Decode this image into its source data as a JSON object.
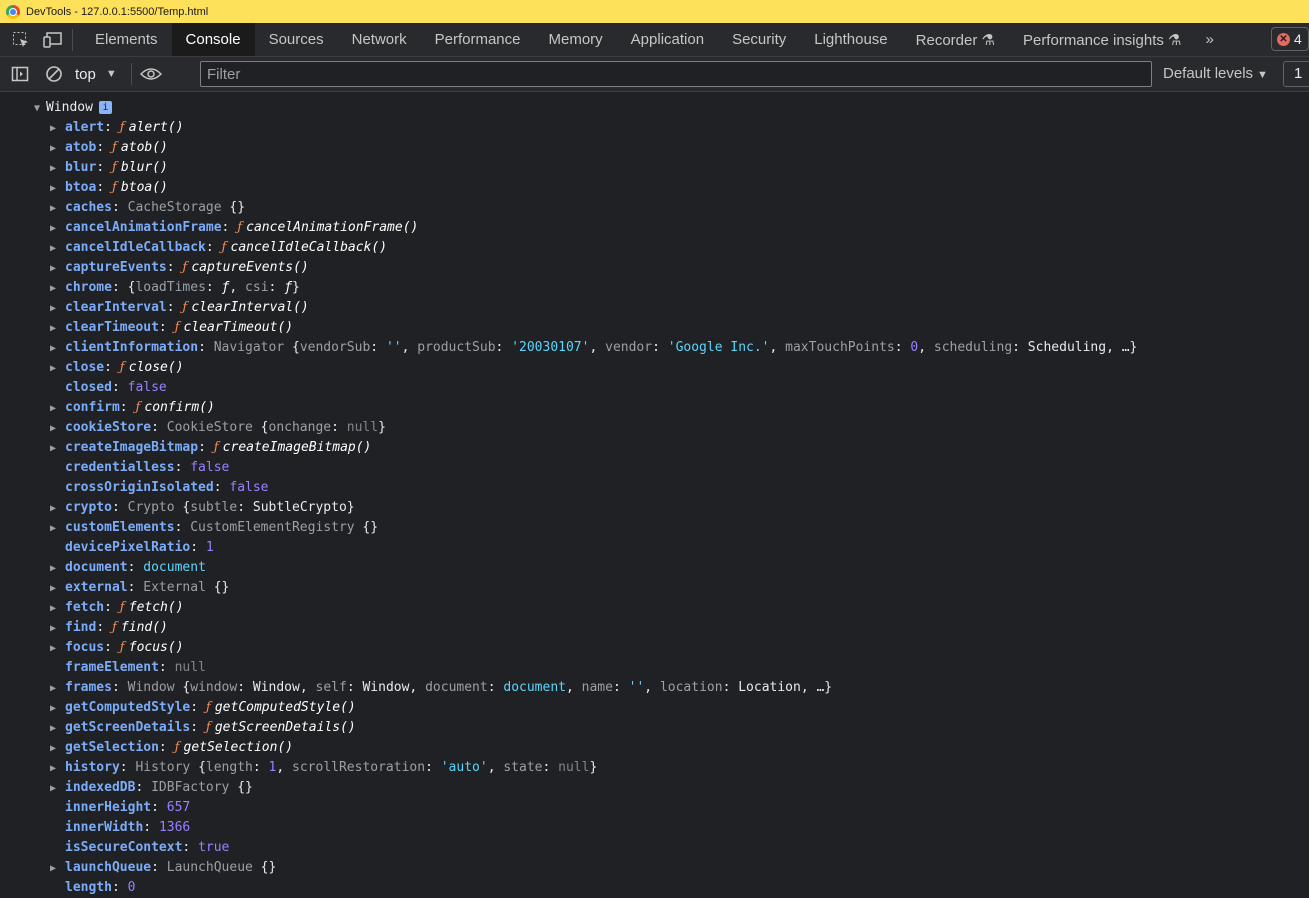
{
  "titlebar": {
    "title": "DevTools - 127.0.0.1:5500/Temp.html"
  },
  "tabs": [
    "Elements",
    "Console",
    "Sources",
    "Network",
    "Performance",
    "Memory",
    "Application",
    "Security",
    "Lighthouse",
    "Recorder ⚗",
    "Performance insights ⚗"
  ],
  "active_tab": "Console",
  "more_tabs": "»",
  "error_count": "4",
  "toolbar": {
    "context": "top",
    "filter_placeholder": "Filter",
    "levels": "Default levels",
    "issues": "1"
  },
  "console": {
    "root_label": "Window",
    "info_badge": "i",
    "rows": [
      {
        "key": "alert",
        "expandable": true,
        "parts": [
          [
            "f",
            "ƒ "
          ],
          [
            "fn",
            "alert()"
          ]
        ]
      },
      {
        "key": "atob",
        "expandable": true,
        "parts": [
          [
            "f",
            "ƒ "
          ],
          [
            "fn",
            "atob()"
          ]
        ]
      },
      {
        "key": "blur",
        "expandable": true,
        "parts": [
          [
            "f",
            "ƒ "
          ],
          [
            "fn",
            "blur()"
          ]
        ]
      },
      {
        "key": "btoa",
        "expandable": true,
        "parts": [
          [
            "f",
            "ƒ "
          ],
          [
            "fn",
            "btoa()"
          ]
        ]
      },
      {
        "key": "caches",
        "expandable": true,
        "parts": [
          [
            "cls",
            "CacheStorage "
          ],
          [
            "plain",
            "{}"
          ]
        ]
      },
      {
        "key": "cancelAnimationFrame",
        "expandable": true,
        "parts": [
          [
            "f",
            "ƒ "
          ],
          [
            "fn",
            "cancelAnimationFrame()"
          ]
        ]
      },
      {
        "key": "cancelIdleCallback",
        "expandable": true,
        "parts": [
          [
            "f",
            "ƒ "
          ],
          [
            "fn",
            "cancelIdleCallback()"
          ]
        ]
      },
      {
        "key": "captureEvents",
        "expandable": true,
        "parts": [
          [
            "f",
            "ƒ "
          ],
          [
            "fn",
            "captureEvents()"
          ]
        ]
      },
      {
        "key": "chrome",
        "expandable": true,
        "parts": [
          [
            "plain",
            "{"
          ],
          [
            "cls",
            "loadTimes"
          ],
          [
            "plain",
            ": "
          ],
          [
            "fn",
            "ƒ"
          ],
          [
            "plain",
            ", "
          ],
          [
            "cls",
            "csi"
          ],
          [
            "plain",
            ": "
          ],
          [
            "fn",
            "ƒ"
          ],
          [
            "plain",
            "}"
          ]
        ]
      },
      {
        "key": "clearInterval",
        "expandable": true,
        "parts": [
          [
            "f",
            "ƒ "
          ],
          [
            "fn",
            "clearInterval()"
          ]
        ]
      },
      {
        "key": "clearTimeout",
        "expandable": true,
        "parts": [
          [
            "f",
            "ƒ "
          ],
          [
            "fn",
            "clearTimeout()"
          ]
        ]
      },
      {
        "key": "clientInformation",
        "expandable": true,
        "parts": [
          [
            "cls",
            "Navigator "
          ],
          [
            "plain",
            "{"
          ],
          [
            "cls",
            "vendorSub"
          ],
          [
            "plain",
            ": "
          ],
          [
            "str",
            "''"
          ],
          [
            "plain",
            ", "
          ],
          [
            "cls",
            "productSub"
          ],
          [
            "plain",
            ": "
          ],
          [
            "str",
            "'20030107'"
          ],
          [
            "plain",
            ", "
          ],
          [
            "cls",
            "vendor"
          ],
          [
            "plain",
            ": "
          ],
          [
            "str",
            "'Google Inc.'"
          ],
          [
            "plain",
            ", "
          ],
          [
            "cls",
            "maxTouchPoints"
          ],
          [
            "plain",
            ": "
          ],
          [
            "num",
            "0"
          ],
          [
            "plain",
            ", "
          ],
          [
            "cls",
            "scheduling"
          ],
          [
            "plain",
            ": Scheduling, …}"
          ]
        ]
      },
      {
        "key": "close",
        "expandable": true,
        "parts": [
          [
            "f",
            "ƒ "
          ],
          [
            "fn",
            "close()"
          ]
        ]
      },
      {
        "key": "closed",
        "expandable": false,
        "parts": [
          [
            "bool",
            "false"
          ]
        ]
      },
      {
        "key": "confirm",
        "expandable": true,
        "parts": [
          [
            "f",
            "ƒ "
          ],
          [
            "fn",
            "confirm()"
          ]
        ]
      },
      {
        "key": "cookieStore",
        "expandable": true,
        "parts": [
          [
            "cls",
            "CookieStore "
          ],
          [
            "plain",
            "{"
          ],
          [
            "cls",
            "onchange"
          ],
          [
            "plain",
            ": "
          ],
          [
            "nul",
            "null"
          ],
          [
            "plain",
            "}"
          ]
        ]
      },
      {
        "key": "createImageBitmap",
        "expandable": true,
        "parts": [
          [
            "f",
            "ƒ "
          ],
          [
            "fn",
            "createImageBitmap()"
          ]
        ]
      },
      {
        "key": "credentialless",
        "expandable": false,
        "parts": [
          [
            "bool",
            "false"
          ]
        ]
      },
      {
        "key": "crossOriginIsolated",
        "expandable": false,
        "parts": [
          [
            "bool",
            "false"
          ]
        ]
      },
      {
        "key": "crypto",
        "expandable": true,
        "parts": [
          [
            "cls",
            "Crypto "
          ],
          [
            "plain",
            "{"
          ],
          [
            "cls",
            "subtle"
          ],
          [
            "plain",
            ": SubtleCrypto}"
          ]
        ]
      },
      {
        "key": "customElements",
        "expandable": true,
        "parts": [
          [
            "cls",
            "CustomElementRegistry "
          ],
          [
            "plain",
            "{}"
          ]
        ]
      },
      {
        "key": "devicePixelRatio",
        "expandable": false,
        "parts": [
          [
            "num",
            "1"
          ]
        ]
      },
      {
        "key": "document",
        "expandable": true,
        "parts": [
          [
            "blue",
            "document"
          ]
        ]
      },
      {
        "key": "external",
        "expandable": true,
        "parts": [
          [
            "cls",
            "External "
          ],
          [
            "plain",
            "{}"
          ]
        ]
      },
      {
        "key": "fetch",
        "expandable": true,
        "parts": [
          [
            "f",
            "ƒ "
          ],
          [
            "fn",
            "fetch()"
          ]
        ]
      },
      {
        "key": "find",
        "expandable": true,
        "parts": [
          [
            "f",
            "ƒ "
          ],
          [
            "fn",
            "find()"
          ]
        ]
      },
      {
        "key": "focus",
        "expandable": true,
        "parts": [
          [
            "f",
            "ƒ "
          ],
          [
            "fn",
            "focus()"
          ]
        ]
      },
      {
        "key": "frameElement",
        "expandable": false,
        "parts": [
          [
            "nul",
            "null"
          ]
        ]
      },
      {
        "key": "frames",
        "expandable": true,
        "parts": [
          [
            "cls",
            "Window "
          ],
          [
            "plain",
            "{"
          ],
          [
            "cls",
            "window"
          ],
          [
            "plain",
            ": Window, "
          ],
          [
            "cls",
            "self"
          ],
          [
            "plain",
            ": Window, "
          ],
          [
            "cls",
            "document"
          ],
          [
            "plain",
            ": "
          ],
          [
            "blue",
            "document"
          ],
          [
            "plain",
            ", "
          ],
          [
            "cls",
            "name"
          ],
          [
            "plain",
            ": "
          ],
          [
            "str",
            "''"
          ],
          [
            "plain",
            ", "
          ],
          [
            "cls",
            "location"
          ],
          [
            "plain",
            ": Location, …}"
          ]
        ]
      },
      {
        "key": "getComputedStyle",
        "expandable": true,
        "parts": [
          [
            "f",
            "ƒ "
          ],
          [
            "fn",
            "getComputedStyle()"
          ]
        ]
      },
      {
        "key": "getScreenDetails",
        "expandable": true,
        "parts": [
          [
            "f",
            "ƒ "
          ],
          [
            "fn",
            "getScreenDetails()"
          ]
        ]
      },
      {
        "key": "getSelection",
        "expandable": true,
        "parts": [
          [
            "f",
            "ƒ "
          ],
          [
            "fn",
            "getSelection()"
          ]
        ]
      },
      {
        "key": "history",
        "expandable": true,
        "parts": [
          [
            "cls",
            "History "
          ],
          [
            "plain",
            "{"
          ],
          [
            "cls",
            "length"
          ],
          [
            "plain",
            ": "
          ],
          [
            "num",
            "1"
          ],
          [
            "plain",
            ", "
          ],
          [
            "cls",
            "scrollRestoration"
          ],
          [
            "plain",
            ": "
          ],
          [
            "str",
            "'auto'"
          ],
          [
            "plain",
            ", "
          ],
          [
            "cls",
            "state"
          ],
          [
            "plain",
            ": "
          ],
          [
            "nul",
            "null"
          ],
          [
            "plain",
            "}"
          ]
        ]
      },
      {
        "key": "indexedDB",
        "expandable": true,
        "parts": [
          [
            "cls",
            "IDBFactory "
          ],
          [
            "plain",
            "{}"
          ]
        ]
      },
      {
        "key": "innerHeight",
        "expandable": false,
        "parts": [
          [
            "num",
            "657"
          ]
        ]
      },
      {
        "key": "innerWidth",
        "expandable": false,
        "parts": [
          [
            "num",
            "1366"
          ]
        ]
      },
      {
        "key": "isSecureContext",
        "expandable": false,
        "parts": [
          [
            "bool",
            "true"
          ]
        ]
      },
      {
        "key": "launchQueue",
        "expandable": true,
        "parts": [
          [
            "cls",
            "LaunchQueue "
          ],
          [
            "plain",
            "{}"
          ]
        ]
      },
      {
        "key": "length",
        "expandable": false,
        "parts": [
          [
            "num",
            "0"
          ]
        ]
      }
    ]
  }
}
